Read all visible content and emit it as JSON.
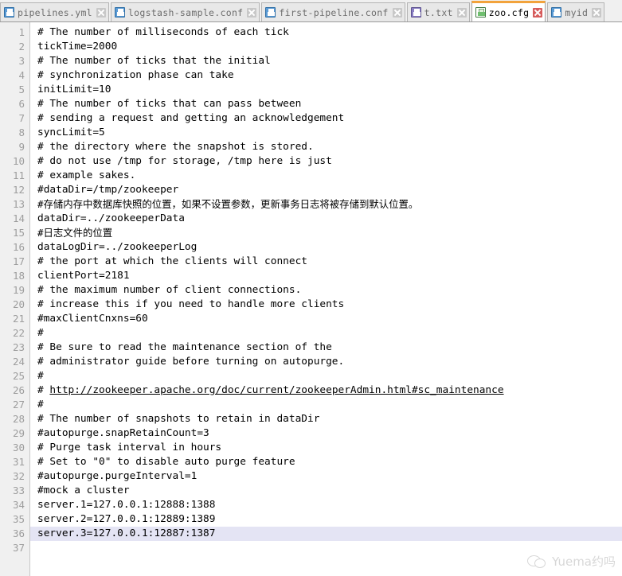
{
  "window": {
    "app_type": "text-editor",
    "accent_active_tab": "#f2a33c",
    "current_line_highlight": "#e4e4f4"
  },
  "tabbar": {
    "tabs": [
      {
        "label": "pipelines.yml",
        "icon": "floppy-disk-blue-icon",
        "icon_color": "#5b9bd5",
        "close_icon": "close-icon",
        "active": false
      },
      {
        "label": "logstash-sample.conf",
        "icon": "floppy-disk-blue-icon",
        "icon_color": "#5b9bd5",
        "close_icon": "close-icon",
        "active": false
      },
      {
        "label": "first-pipeline.conf",
        "icon": "floppy-disk-blue-icon",
        "icon_color": "#5b9bd5",
        "close_icon": "close-icon",
        "active": false
      },
      {
        "label": "t.txt",
        "icon": "floppy-disk-purple-icon",
        "icon_color": "#8b7fc4",
        "close_icon": "close-icon",
        "active": false
      },
      {
        "label": "zoo.cfg",
        "icon": "floppy-disk-green-icon",
        "icon_color": "#6fbf6f",
        "close_icon": "close-icon-red",
        "active": true
      },
      {
        "label": "myid",
        "icon": "floppy-disk-blue-icon",
        "icon_color": "#5b9bd5",
        "close_icon": "close-icon",
        "active": false
      }
    ]
  },
  "editor": {
    "filename": "zoo.cfg",
    "current_line": 36,
    "total_lines": 37,
    "lines": [
      {
        "n": 1,
        "text": "# The number of milliseconds of each tick"
      },
      {
        "n": 2,
        "text": "tickTime=2000"
      },
      {
        "n": 3,
        "text": "# The number of ticks that the initial"
      },
      {
        "n": 4,
        "text": "# synchronization phase can take"
      },
      {
        "n": 5,
        "text": "initLimit=10"
      },
      {
        "n": 6,
        "text": "# The number of ticks that can pass between"
      },
      {
        "n": 7,
        "text": "# sending a request and getting an acknowledgement"
      },
      {
        "n": 8,
        "text": "syncLimit=5"
      },
      {
        "n": 9,
        "text": "# the directory where the snapshot is stored."
      },
      {
        "n": 10,
        "text": "# do not use /tmp for storage, /tmp here is just"
      },
      {
        "n": 11,
        "text": "# example sakes."
      },
      {
        "n": 12,
        "text": "#dataDir=/tmp/zookeeper"
      },
      {
        "n": 13,
        "text": "#存储内存中数据库快照的位置，如果不设置参数，更新事务日志将被存储到默认位置。",
        "cjk": true
      },
      {
        "n": 14,
        "text": "dataDir=../zookeeperData"
      },
      {
        "n": 15,
        "text": "#日志文件的位置",
        "cjk": true
      },
      {
        "n": 16,
        "text": "dataLogDir=../zookeeperLog"
      },
      {
        "n": 17,
        "text": "# the port at which the clients will connect"
      },
      {
        "n": 18,
        "text": "clientPort=2181"
      },
      {
        "n": 19,
        "text": "# the maximum number of client connections."
      },
      {
        "n": 20,
        "text": "# increase this if you need to handle more clients"
      },
      {
        "n": 21,
        "text": "#maxClientCnxns=60"
      },
      {
        "n": 22,
        "text": "#"
      },
      {
        "n": 23,
        "text": "# Be sure to read the maintenance section of the"
      },
      {
        "n": 24,
        "text": "# administrator guide before turning on autopurge."
      },
      {
        "n": 25,
        "text": "#"
      },
      {
        "n": 26,
        "prefix": "# ",
        "link": "http://zookeeper.apache.org/doc/current/zookeeperAdmin.html#sc_maintenance"
      },
      {
        "n": 27,
        "text": "#"
      },
      {
        "n": 28,
        "text": "# The number of snapshots to retain in dataDir"
      },
      {
        "n": 29,
        "text": "#autopurge.snapRetainCount=3"
      },
      {
        "n": 30,
        "text": "# Purge task interval in hours"
      },
      {
        "n": 31,
        "text": "# Set to \"0\" to disable auto purge feature"
      },
      {
        "n": 32,
        "text": "#autopurge.purgeInterval=1"
      },
      {
        "n": 33,
        "text": "#mock a cluster"
      },
      {
        "n": 34,
        "text": "server.1=127.0.0.1:12888:1388"
      },
      {
        "n": 35,
        "text": "server.2=127.0.0.1:12889:1389"
      },
      {
        "n": 36,
        "text": "server.3=127.0.0.1:12887:1387",
        "highlight": true
      },
      {
        "n": 37,
        "text": ""
      }
    ]
  },
  "watermark": {
    "text": "Yuema约吗",
    "icon": "chat-bubbles-icon"
  }
}
